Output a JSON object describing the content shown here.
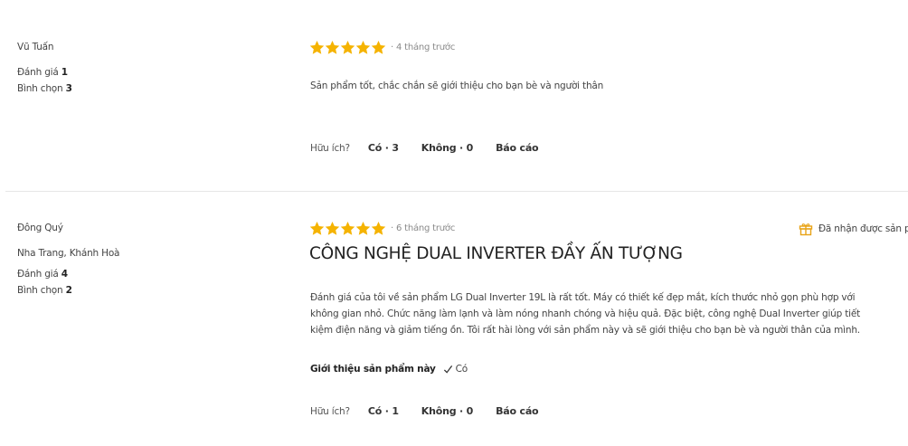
{
  "reviews": [
    {
      "author": "Vũ Tuấn",
      "location": "",
      "rating_label": "Đánh giá",
      "rating_count": "1",
      "votes_label": "Bình chọn",
      "votes_count": "3",
      "stars": 5,
      "time": "· 4 tháng trước",
      "title": "",
      "body": "Sản phẩm tốt, chắc chắn sẽ giới thiệu cho bạn bè và người thân",
      "helpful_question": "Hữu ích?",
      "yes_label": "Có · 3",
      "no_label": "Không · 0",
      "report_label": "Báo cáo"
    },
    {
      "author": "Đông Quý",
      "location": "Nha Trang, Khánh Hoà",
      "rating_label": "Đánh giá",
      "rating_count": "4",
      "votes_label": "Bình chọn",
      "votes_count": "2",
      "stars": 5,
      "time": "· 6 tháng trước",
      "title": "CÔNG NGHỆ DUAL INVERTER ĐẦY ẤN TƯỢNG",
      "body": "Đánh giá của tôi về sản phẩm LG Dual Inverter 19L là rất tốt. Máy có thiết kế đẹp mắt, kích thước nhỏ gọn phù hợp với không gian nhỏ. Chức năng làm lạnh và làm nóng nhanh chóng và hiệu quả. Đặc biệt, công nghệ Dual Inverter giúp tiết kiệm điện năng và giảm tiếng ồn. Tôi rất hài lòng với sản phẩm này và sẽ giới thiệu cho bạn bè và người thân của mình.",
      "recommend_label": "Giới thiệu sản phẩm này",
      "recommend_value": "Có",
      "received_label": "Đã nhận được sản ph",
      "helpful_question": "Hữu ích?",
      "yes_label": "Có · 1",
      "no_label": "Không · 0",
      "report_label": "Báo cáo"
    }
  ],
  "colors": {
    "star": "#f5b301",
    "gift": "#e8a317",
    "divider": "#e6e6e6"
  },
  "icons": {
    "star": "star-icon",
    "check": "check-icon",
    "gift": "gift-icon"
  }
}
